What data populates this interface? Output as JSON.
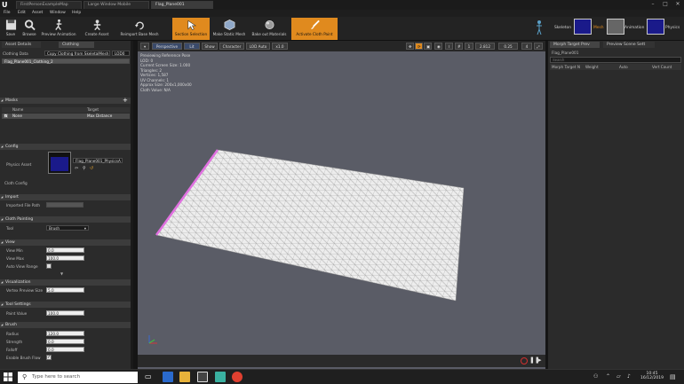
{
  "window": {
    "tabs": [
      {
        "label": "FirstPersonExampleMap"
      },
      {
        "label": "Large Window Mobile"
      },
      {
        "label": "Flag_Plane001"
      }
    ]
  },
  "menu": {
    "items": [
      "File",
      "Edit",
      "Asset",
      "Window",
      "Help"
    ]
  },
  "toolbar": {
    "buttons": [
      {
        "label": "Save"
      },
      {
        "label": "Browse"
      },
      {
        "label": "Preview Animation"
      },
      {
        "label": "Create Asset"
      },
      {
        "label": "Reimport Base Mesh"
      },
      {
        "label": "Section Selection"
      },
      {
        "label": "Make Static Mesh"
      },
      {
        "label": "Bake out Materials"
      },
      {
        "label": "Activate Cloth Paint"
      }
    ],
    "modes": [
      {
        "label": "Skeleton"
      },
      {
        "label": "Mesh"
      },
      {
        "label": "Animation"
      },
      {
        "label": "Physics"
      }
    ]
  },
  "left_panel": {
    "tabs": [
      "Asset Details",
      "Clothing"
    ],
    "clothing_data_label": "Clothing Data",
    "copy_btn": "Copy Clothing from SkeletalMesh",
    "lod_label": "LOD0",
    "clothing_item": "Flag_Plane001_Clothing_2",
    "masks": {
      "title": "Masks",
      "col_name": "Name",
      "col_target": "Target",
      "row_name": "None",
      "row_target": "Max Distance"
    },
    "config": {
      "title": "Config",
      "physics_asset_label": "Physics Asset",
      "physics_asset_value": "Flag_Plane001_PhysicsA",
      "cloth_config_label": "Cloth Config"
    },
    "import": {
      "title": "Import",
      "file_path_label": "Imported File Path"
    },
    "cloth_painting": {
      "title": "Cloth Painting",
      "tool_label": "Tool",
      "tool_value": "Brush"
    },
    "view": {
      "title": "View",
      "view_min_label": "View Min",
      "view_min": "0.0",
      "view_max_label": "View Max",
      "view_max": "100.0",
      "auto_range_label": "Auto View Range"
    },
    "visualization": {
      "title": "Visualization",
      "vertex_size_label": "Vertex Preview Size",
      "vertex_size": "5.0"
    },
    "tool_settings": {
      "title": "Tool Settings",
      "paint_value_label": "Paint Value",
      "paint_value": "100.0"
    },
    "brush": {
      "title": "Brush",
      "radius_label": "Radius",
      "radius": "120.0",
      "strength_label": "Strength",
      "strength": "0.0",
      "falloff_label": "Falloff",
      "falloff": "0.0",
      "enable_falloff_label": "Enable Brush Flow"
    }
  },
  "viewport": {
    "buttons": [
      "Perspective",
      "Lit",
      "Show",
      "Character",
      "LOD Auto",
      "x1.0"
    ],
    "right_values": [
      "1",
      "2.812",
      "0.25",
      "4"
    ],
    "stats": [
      "Previewing Reference Pose",
      "LOD: 0",
      "Current Screen Size: 1.000",
      "Triangles: 2",
      "Vertices: 1,587",
      "UV Channels: 1",
      "Approx Size: 200x1,000x00",
      "Cloth Value: N/A"
    ]
  },
  "right_panel": {
    "tabs": [
      "Morph Target Prev",
      "Preview Scene Sett"
    ],
    "asset_name": "Flag_Plane001",
    "search_placeholder": "Search",
    "col_name": "Morph Target N",
    "col_weight": "Weight",
    "col_auto": "Auto",
    "col_vert": "Vert Count"
  },
  "taskbar": {
    "search_placeholder": "Type here to search",
    "time": "10:45",
    "date": "16/12/2019"
  },
  "colors": {
    "accent": "#e08a1e",
    "viewport_bg": "#5a5c66",
    "mesh_edge": "#e070e0"
  }
}
